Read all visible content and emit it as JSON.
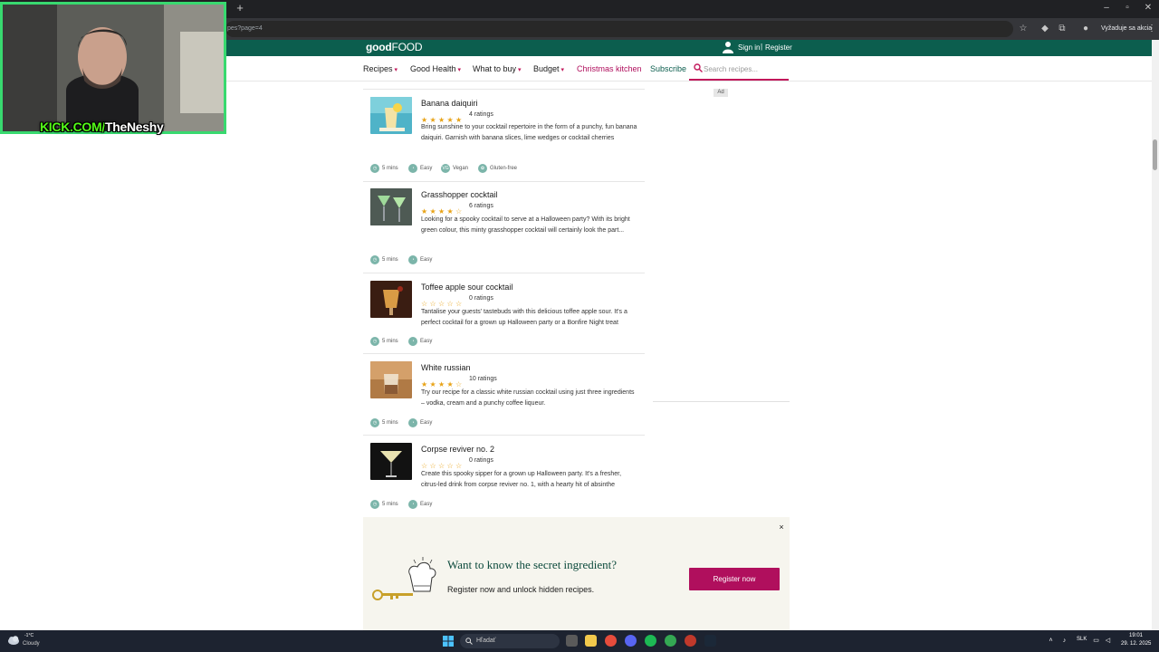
{
  "browser": {
    "url_fragment": "pes?page=4",
    "update_button": "Vyžaduje sa akcia",
    "new_tab_symbol": "+"
  },
  "site": {
    "logo_bold": "good",
    "logo_light": "FOOD",
    "sign_in": "Sign in",
    "register": "Register",
    "separator": "|"
  },
  "nav": {
    "items": [
      {
        "label": "Recipes",
        "caret": "▾"
      },
      {
        "label": "Good Health",
        "caret": "▾"
      },
      {
        "label": "What to buy",
        "caret": "▾"
      },
      {
        "label": "Budget",
        "caret": "▾"
      },
      {
        "label": "Christmas kitchen"
      },
      {
        "label": "Subscribe"
      }
    ],
    "search_placeholder": "Search recipes..."
  },
  "recipes": [
    {
      "title": "Banana daiquiri",
      "rating": 5,
      "ratings_text": "4 ratings",
      "description": "Bring sunshine to your cocktail repertoire in the form of a punchy, fun banana daiquiri. Garnish with banana slices, lime wedges or cocktail cherries",
      "meta": [
        {
          "icon": "clock-icon",
          "label": "5 mins"
        },
        {
          "icon": "skill-icon",
          "label": "Easy"
        },
        {
          "icon": "vegan-icon",
          "label": "Vegan",
          "badge": "VG"
        },
        {
          "icon": "gluten-free-icon",
          "label": "Gluten-free"
        }
      ]
    },
    {
      "title": "Grasshopper cocktail",
      "rating": 4,
      "ratings_text": "6 ratings",
      "description": "Looking for a spooky cocktail to serve at a Halloween party? With its bright green colour, this minty grasshopper cocktail will certainly look the part...",
      "meta": [
        {
          "icon": "clock-icon",
          "label": "5 mins"
        },
        {
          "icon": "skill-icon",
          "label": "Easy"
        }
      ]
    },
    {
      "title": "Toffee apple sour cocktail",
      "rating": 0,
      "ratings_text": "0 ratings",
      "description": "Tantalise your guests' tastebuds with this delicious toffee apple sour. It's a perfect cocktail for a grown up Halloween party or a Bonfire Night treat",
      "meta": [
        {
          "icon": "clock-icon",
          "label": "5 mins"
        },
        {
          "icon": "skill-icon",
          "label": "Easy"
        }
      ]
    },
    {
      "title": "White russian",
      "rating": 4,
      "ratings_text": "10 ratings",
      "description": "Try our recipe for a classic white russian cocktail using just three ingredients – vodka, cream and a punchy coffee liqueur.",
      "meta": [
        {
          "icon": "clock-icon",
          "label": "5 mins"
        },
        {
          "icon": "skill-icon",
          "label": "Easy"
        }
      ]
    },
    {
      "title": "Corpse reviver no. 2",
      "rating": 0,
      "ratings_text": "0 ratings",
      "description": "Create this spooky sipper for a grown up Halloween party. It's a fresher, citrus-led drink from corpse reviver no. 1, with a hearty hit of absinthe",
      "meta": [
        {
          "icon": "clock-icon",
          "label": "5 mins"
        },
        {
          "icon": "skill-icon",
          "label": "Easy"
        }
      ]
    }
  ],
  "ad": {
    "label": "Ad"
  },
  "promo": {
    "title": "Want to know the secret ingredient?",
    "subtitle": "Register now and unlock hidden recipes.",
    "button": "Register now",
    "close": "×"
  },
  "overlay": {
    "kick_prefix": "KICK.COM/",
    "kick_name": "TheNeshy"
  },
  "taskbar": {
    "weather_temp": "-1°C",
    "weather_text": "Cloudy",
    "search_placeholder": "Hľadať",
    "language": "SLK",
    "time": "19:01",
    "date": "29. 12. 2025"
  },
  "colors": {
    "brand_green": "#0c5e4e",
    "accent_pink": "#b00f5d",
    "star": "#e8a317",
    "kick_green": "#53fc18"
  }
}
